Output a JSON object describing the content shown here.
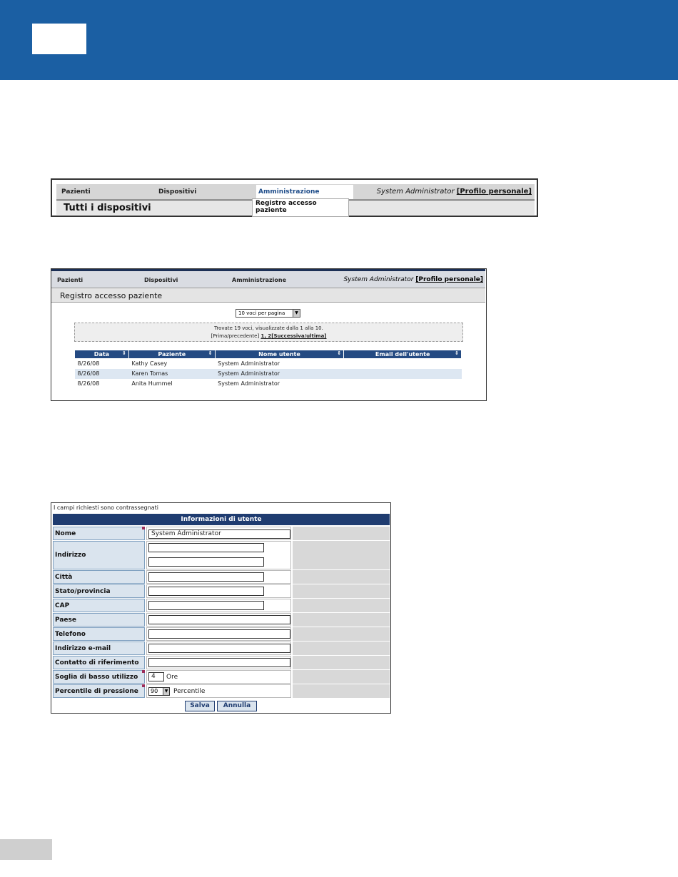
{
  "shot1": {
    "nav": [
      "Pazienti",
      "Dispositivi",
      "Amministrazione"
    ],
    "user_name": "System Administrator",
    "profile_link": "[Profilo personale]",
    "page_title": "Tutti i dispositivi",
    "dropdown_item": "Registro accesso paziente"
  },
  "shot2": {
    "nav": [
      "Pazienti",
      "Dispositivi",
      "Amministrazione"
    ],
    "user_name": "System Administrator",
    "profile_link": "[Profilo personale]",
    "page_title": "Registro accesso paziente",
    "per_page": "10 voci per pagina",
    "info_line1": "Trovate 19 voci, visualizzate dalla 1 alla 10.",
    "info_prefix": "[Prima/precedente]",
    "info_pages": "1, 2",
    "info_next": "[Successiva/ultima]",
    "columns": [
      "Data",
      "Paziente",
      "Nome utente",
      "Email dell'utente"
    ],
    "rows": [
      [
        "8/26/08",
        "Kathy Casey",
        "System Administrator",
        ""
      ],
      [
        "8/26/08",
        "Karen Tomas",
        "System Administrator",
        ""
      ],
      [
        "8/26/08",
        "Anita Hummel",
        "System Administrator",
        ""
      ]
    ]
  },
  "shot3": {
    "required_note": "I campi richiesti sono contrassegnati",
    "section_title": "Informazioni di utente",
    "labels": {
      "nome": "Nome",
      "indirizzo": "Indirizzo",
      "citta": "Città",
      "stato": "Stato/provincia",
      "cap": "CAP",
      "paese": "Paese",
      "telefono": "Telefono",
      "email": "Indirizzo e-mail",
      "contatto": "Contatto di riferimento",
      "soglia": "Soglia di basso utilizzo",
      "percentile": "Percentile di pressione"
    },
    "values": {
      "nome": "System Administrator",
      "soglia": "4",
      "soglia_unit": "Ore",
      "percentile": "90",
      "percentile_unit": "Percentile"
    },
    "save_label": "Salva",
    "cancel_label": "Annulla"
  }
}
